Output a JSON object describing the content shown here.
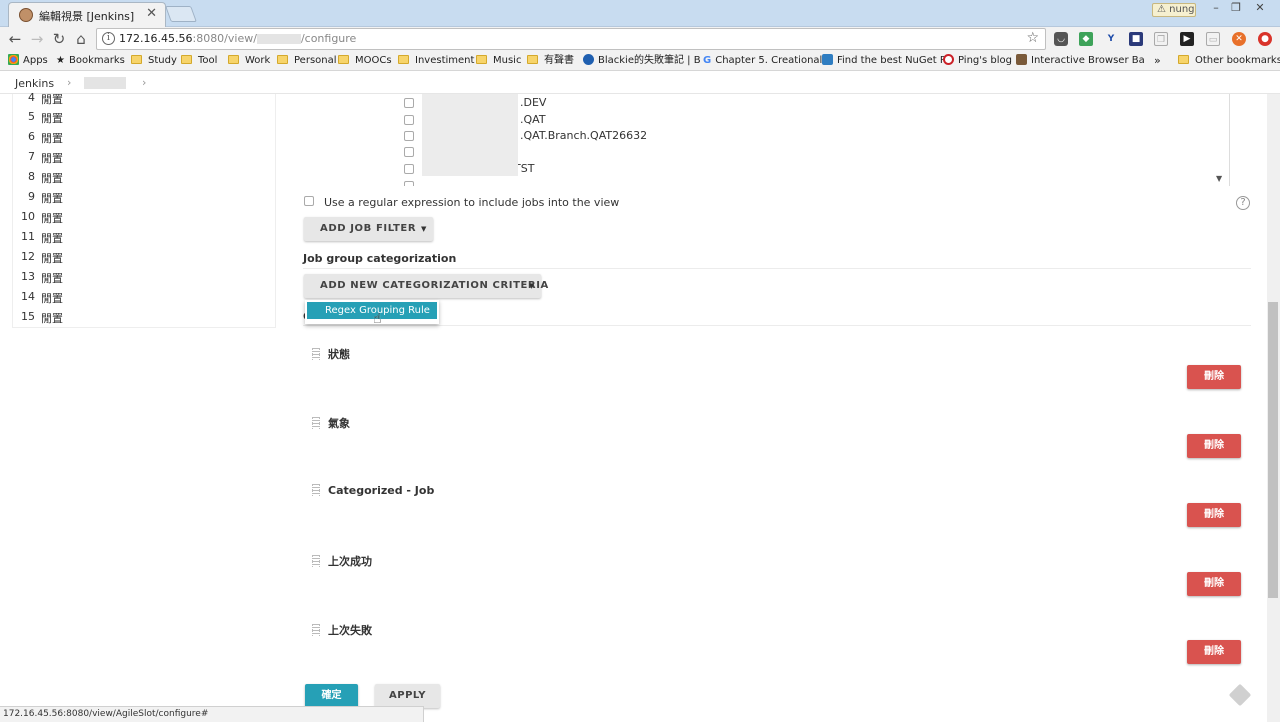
{
  "browser": {
    "tab_title": "編輯視景 [Jenkins]",
    "tab_close": "✕",
    "profile_name": "nung",
    "url_host": "172.16.45.56",
    "url_rest_a": ":8080/view/",
    "url_rest_b": "/configure",
    "window_minimize": "–",
    "window_restore": "❐",
    "window_close": "✕"
  },
  "bookmarks": [
    {
      "label": "Apps",
      "kind": "apps"
    },
    {
      "label": "Bookmarks",
      "kind": "star"
    },
    {
      "label": "Study",
      "kind": "folder"
    },
    {
      "label": "Tool",
      "kind": "folder"
    },
    {
      "label": "Work",
      "kind": "folder"
    },
    {
      "label": "Personal",
      "kind": "folder"
    },
    {
      "label": "MOOCs",
      "kind": "folder"
    },
    {
      "label": "Investiment",
      "kind": "folder"
    },
    {
      "label": "Music",
      "kind": "folder"
    },
    {
      "label": "有聲書",
      "kind": "folder"
    },
    {
      "label": "Blackie的失敗筆記 | B",
      "kind": "site"
    },
    {
      "label": "Chapter 5. Creational",
      "kind": "google"
    },
    {
      "label": "Find the best NuGet P",
      "kind": "site"
    },
    {
      "label": "Ping's blog",
      "kind": "pinterest"
    },
    {
      "label": "Interactive Browser Ba",
      "kind": "site"
    },
    {
      "label": "»",
      "kind": "more"
    },
    {
      "label": "Other bookmarks",
      "kind": "folder"
    }
  ],
  "breadcrumb": {
    "root": "Jenkins",
    "sep": "›"
  },
  "sidebar": {
    "rows": [
      {
        "num": "4",
        "status": "閒置"
      },
      {
        "num": "5",
        "status": "閒置"
      },
      {
        "num": "6",
        "status": "閒置"
      },
      {
        "num": "7",
        "status": "閒置"
      },
      {
        "num": "8",
        "status": "閒置"
      },
      {
        "num": "9",
        "status": "閒置"
      },
      {
        "num": "10",
        "status": "閒置"
      },
      {
        "num": "11",
        "status": "閒置"
      },
      {
        "num": "12",
        "status": "閒置"
      },
      {
        "num": "13",
        "status": "閒置"
      },
      {
        "num": "14",
        "status": "閒置"
      },
      {
        "num": "15",
        "status": "閒置"
      }
    ]
  },
  "jobs_list": [
    {
      "label": ".DEV"
    },
    {
      "label": ".QAT"
    },
    {
      "label": ".QAT.Branch.QAT26632"
    },
    {
      "label": ""
    },
    {
      "label": "TST"
    },
    {
      "label": ""
    }
  ],
  "filters": {
    "regex_label": "Use a regular expression to include jobs into the view",
    "help": "?",
    "add_job_filter": "ADD JOB FILTER"
  },
  "categorization": {
    "title": "Job group categorization",
    "add_criteria": "ADD NEW CATEGORIZATION CRITERIA",
    "menu_item": "Regex Grouping Rule",
    "hidden_heading": "C"
  },
  "columns": [
    {
      "label": "狀態",
      "delete": "刪除"
    },
    {
      "label": "氣象",
      "delete": "刪除"
    },
    {
      "label": "Categorized - Job",
      "delete": "刪除"
    },
    {
      "label": "上次成功",
      "delete": "刪除"
    },
    {
      "label": "上次失敗",
      "delete": "刪除"
    }
  ],
  "actions": {
    "ok": "確定",
    "apply": "APPLY"
  },
  "status_url": "172.16.45.56:8080/view/AgileSlot/configure#",
  "colors": {
    "teal": "#26a0b6",
    "red": "#d9534f"
  }
}
